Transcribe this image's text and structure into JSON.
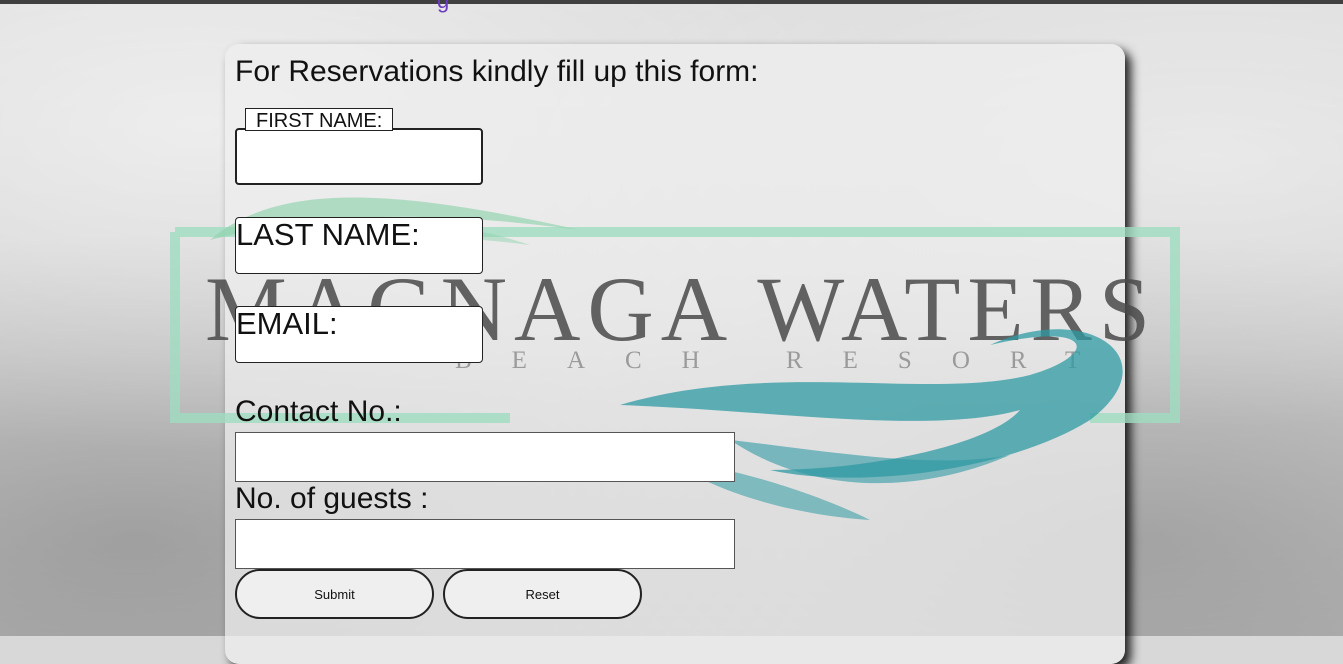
{
  "page": {
    "nav_fragment": "g"
  },
  "logo": {
    "brand_name": "MAGNAGA WATERS",
    "brand_subtitle": "BEACH RESORT",
    "colors": {
      "frame": "#9fdcbf",
      "wave": "#2f9aa3",
      "text": "#4a4a4a"
    }
  },
  "form": {
    "title": "For Reservations kindly fill up this form:",
    "first_name_label": "FIRST NAME:",
    "last_name_label": "LAST NAME:",
    "email_label": "EMAIL:",
    "contact_label": "Contact No.:",
    "contact_value": "",
    "guests_label": "No. of guests :",
    "guests_value": "",
    "submit_label": "Submit",
    "reset_label": "Reset"
  }
}
